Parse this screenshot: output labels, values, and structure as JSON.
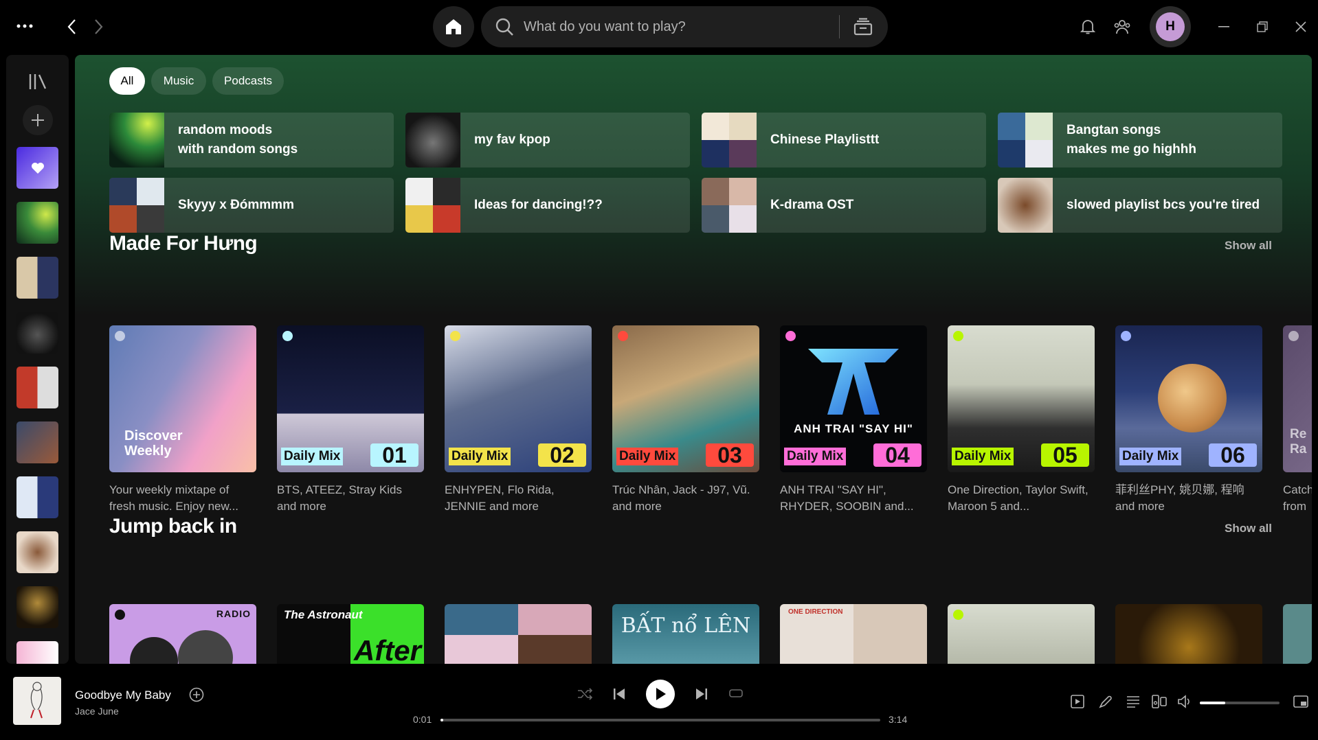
{
  "topbar": {
    "search_placeholder": "What do you want to play?",
    "avatar_initial": "H"
  },
  "filters": [
    {
      "label": "All",
      "active": true
    },
    {
      "label": "Music",
      "active": false
    },
    {
      "label": "Podcasts",
      "active": false
    }
  ],
  "quick_access": [
    {
      "title": "random moods\nwith random songs"
    },
    {
      "title": "my fav kpop"
    },
    {
      "title": "Chinese Playlisttt"
    },
    {
      "title": "Bangtan songs\nmakes me go highhh"
    },
    {
      "title": "Skyyy x Đómmmm"
    },
    {
      "title": "Ideas for dancing!??"
    },
    {
      "title": "K-drama OST"
    },
    {
      "title": "slowed playlist bcs you're tired"
    }
  ],
  "made_for": {
    "title": "Made For Hưng",
    "show_all": "Show all",
    "cards": [
      {
        "cover_text": "Discover\nWeekly",
        "desc": "Your weekly mixtape of fresh music. Enjoy new..."
      },
      {
        "tag": "Daily Mix",
        "num": "01",
        "desc": "BTS, ATEEZ, Stray Kids and more"
      },
      {
        "tag": "Daily Mix",
        "num": "02",
        "desc": "ENHYPEN, Flo Rida, JENNIE and more"
      },
      {
        "tag": "Daily Mix",
        "num": "03",
        "desc": "Trúc Nhân, Jack - J97, Vũ. and more"
      },
      {
        "tag": "Daily Mix",
        "num": "04",
        "cover_text": "ANH TRAI \"SAY HI\"",
        "desc": "ANH TRAI \"SAY HI\", RHYDER, SOOBIN and..."
      },
      {
        "tag": "Daily Mix",
        "num": "05",
        "desc": "One Direction, Taylor Swift, Maroon 5 and..."
      },
      {
        "tag": "Daily Mix",
        "num": "06",
        "desc": "菲利丝PHY, 姚贝娜, 程响 and more"
      },
      {
        "cover_text": "Re\nRa",
        "desc": "Catch\nfrom"
      }
    ]
  },
  "jump_back": {
    "title": "Jump back in",
    "show_all": "Show all",
    "radio_label": "RADIO",
    "astronaut_label": "The Astronaut",
    "after_label": "After",
    "bat_label": "BẤT nổ LÊN",
    "od_label": "ONE DIRECTION"
  },
  "player": {
    "title": "Goodbye My Baby",
    "artist": "Jace June",
    "elapsed": "0:01",
    "duration": "3:14",
    "progress": 0.005,
    "volume": 0.32
  },
  "colors": {
    "accent": "#1ed760",
    "tag_01": "#b8f5ff",
    "tag_02": "#f3e34a",
    "tag_03": "#ff4a3d",
    "tag_04": "#ff6dd8",
    "tag_05": "#b8f500",
    "tag_06": "#9fb3ff"
  }
}
